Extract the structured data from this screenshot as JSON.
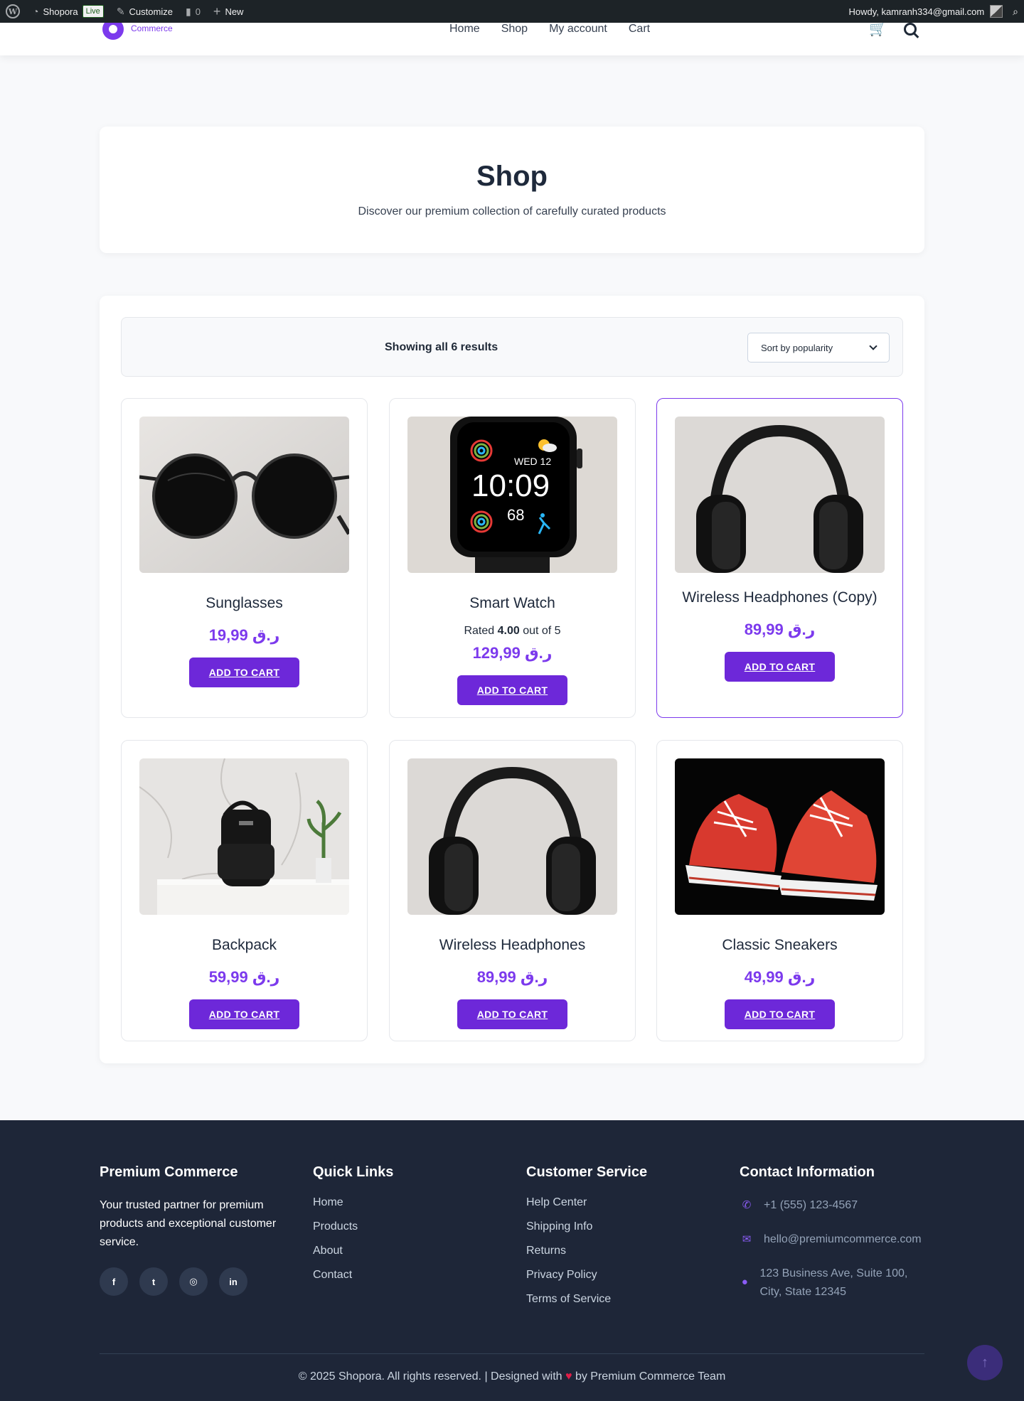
{
  "adminbar": {
    "site_name": "Shopora",
    "live_badge": "Live",
    "customize": "Customize",
    "comments_count": "0",
    "new_label": "New",
    "howdy": "Howdy, kamranh334@gmail.com"
  },
  "header": {
    "logo_sub": "Commerce",
    "nav": [
      "Home",
      "Shop",
      "My account",
      "Cart"
    ]
  },
  "hero": {
    "title": "Shop",
    "subtitle": "Discover our premium collection of carefully curated products"
  },
  "shop": {
    "result_count": "Showing all 6 results",
    "orderby_selected": "Sort by popularity",
    "add_to_cart_label": "ADD TO CART",
    "products": [
      {
        "name": "Sunglasses",
        "price": "ر.ق 19,99"
      },
      {
        "name": "Smart Watch",
        "rating_prefix": "Rated",
        "rating_value": "4.00",
        "rating_suffix": "out of 5",
        "price": "ر.ق 129,99",
        "watch_date": "WED 12",
        "watch_time": "10:09",
        "watch_hr": "68"
      },
      {
        "name": "Wireless Headphones (Copy)",
        "price": "ر.ق 89,99"
      },
      {
        "name": "Backpack",
        "price": "ر.ق 59,99"
      },
      {
        "name": "Wireless Headphones",
        "price": "ر.ق 89,99"
      },
      {
        "name": "Classic Sneakers",
        "price": "ر.ق 49,99"
      }
    ]
  },
  "footer": {
    "about": {
      "title": "Premium Commerce",
      "desc": "Your trusted partner for premium products and exceptional customer service.",
      "social": [
        "facebook-icon",
        "twitter-icon",
        "instagram-icon",
        "linkedin-icon"
      ]
    },
    "quick_links": {
      "title": "Quick Links",
      "items": [
        "Home",
        "Products",
        "About",
        "Contact"
      ]
    },
    "service": {
      "title": "Customer Service",
      "items": [
        "Help Center",
        "Shipping Info",
        "Returns",
        "Privacy Policy",
        "Terms of Service"
      ]
    },
    "contact": {
      "title": "Contact Information",
      "phone": "+1 (555) 123-4567",
      "email": "hello@premiumcommerce.com",
      "address": "123 Business Ave, Suite 100, City, State 12345"
    },
    "copyright_a": "© 2025 Shopora. All rights reserved. | Designed with",
    "copyright_b": "by Premium Commerce Team"
  },
  "colors": {
    "accent": "#7c3aed",
    "button": "#6d28d9",
    "footer_bg": "#1e2638",
    "adminbar_bg": "#1d2327"
  }
}
